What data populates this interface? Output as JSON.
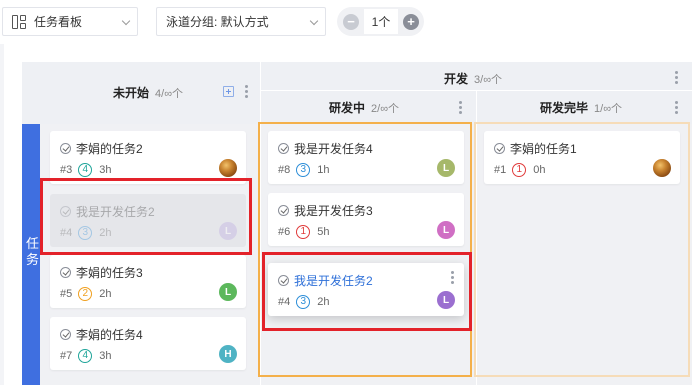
{
  "toolbar": {
    "view_select": "任务看板",
    "lane_select": "泳道分组: 默认方式",
    "stepper_minus": "−",
    "stepper_value": "1个",
    "stepper_plus": "+"
  },
  "columns": {
    "not_started": {
      "name": "未开始",
      "count": "4/∞个"
    },
    "dev": {
      "name": "开发",
      "count": "3/∞个"
    },
    "in_dev": {
      "name": "研发中",
      "count": "2/∞个"
    },
    "dev_done": {
      "name": "研发完毕",
      "count": "1/∞个"
    }
  },
  "lane": {
    "label": "任务"
  },
  "cards": {
    "c1": {
      "title": "李娟的任务2",
      "id": "#3",
      "priority": "4",
      "hours": "3h",
      "avatar": ""
    },
    "ghost": {
      "title": "我是开发任务2",
      "id": "#4",
      "priority": "3",
      "hours": "2h",
      "avatar": "L"
    },
    "c3": {
      "title": "李娟的任务3",
      "id": "#5",
      "priority": "2",
      "hours": "2h",
      "avatar": "L"
    },
    "c4": {
      "title": "李娟的任务4",
      "id": "#7",
      "priority": "4",
      "hours": "3h",
      "avatar": "H"
    },
    "d1": {
      "title": "我是开发任务4",
      "id": "#8",
      "priority": "3",
      "hours": "1h",
      "avatar": "L"
    },
    "d2": {
      "title": "我是开发任务3",
      "id": "#6",
      "priority": "1",
      "hours": "5h",
      "avatar": "L"
    },
    "dragging": {
      "title": "我是开发任务2",
      "id": "#4",
      "priority": "3",
      "hours": "2h",
      "avatar": "L"
    },
    "e1": {
      "title": "李娟的任务1",
      "id": "#1",
      "priority": "1",
      "hours": "0h",
      "avatar": ""
    }
  },
  "colors": {
    "lane": "#3f6fe0",
    "drop_target": "#f4b04a",
    "highlight": "#e3222a",
    "avatar_green": "#5cb85c",
    "avatar_olive": "#a6b86a",
    "avatar_purple": "#9b6fd0",
    "avatar_pink": "#d06fc4",
    "avatar_teal": "#4fb3c4"
  }
}
